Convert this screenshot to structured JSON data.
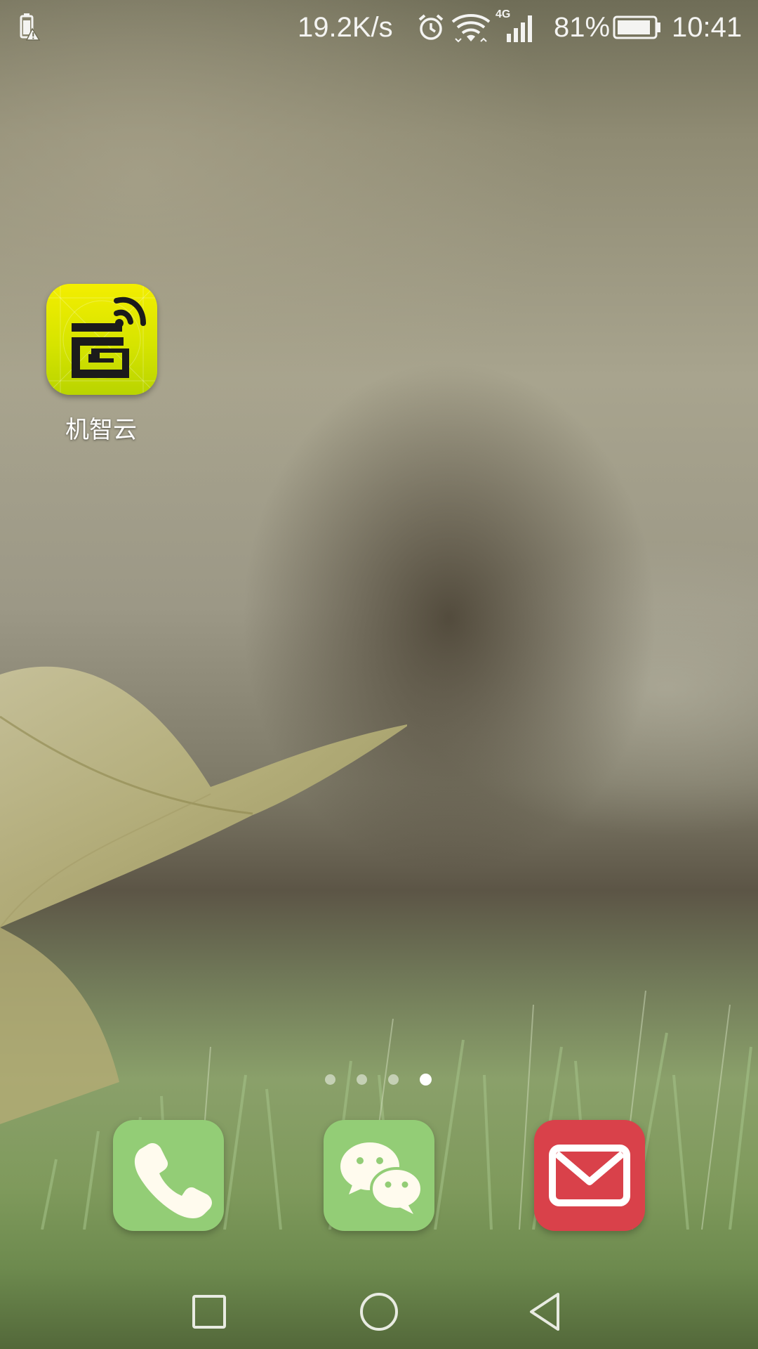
{
  "status_bar": {
    "battery_alert_icon": "battery-warning-icon",
    "network_speed": "19.2K/s",
    "alarm_icon": "alarm-clock-icon",
    "wifi_icon": "wifi-icon",
    "signal_label": "4G",
    "battery_percent": "81%",
    "battery_icon": "battery-icon",
    "time": "10:41"
  },
  "home_apps": [
    {
      "label": "机智云",
      "icon": "jizhiyun-app-icon",
      "color": "#e8ea00"
    }
  ],
  "page_indicator": {
    "count": 4,
    "active_index": 3
  },
  "dock": [
    {
      "name": "phone",
      "icon": "phone-icon",
      "color": "#93cd76"
    },
    {
      "name": "wechat",
      "icon": "wechat-icon",
      "color": "#93cd76"
    },
    {
      "name": "email",
      "icon": "email-icon",
      "color": "#d9414a"
    }
  ],
  "nav_bar": {
    "recent_icon": "square-recent-apps-icon",
    "home_icon": "circle-home-icon",
    "back_icon": "triangle-back-icon"
  }
}
